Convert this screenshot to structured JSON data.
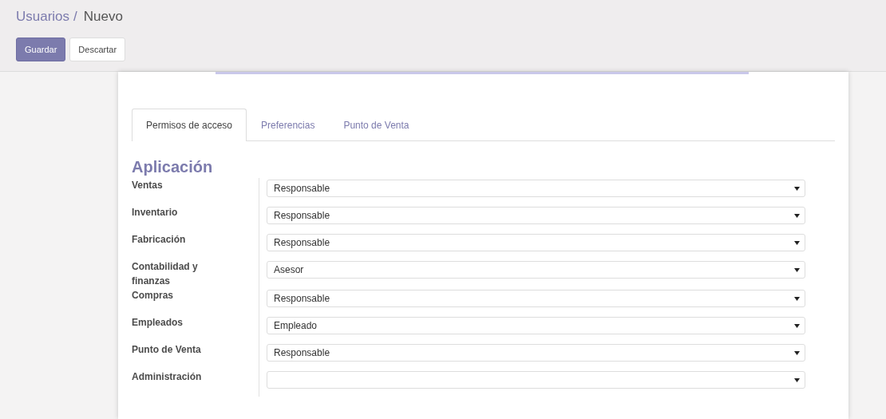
{
  "breadcrumb": {
    "parent": "Usuarios",
    "separator": "/",
    "current": "Nuevo"
  },
  "buttons": [
    {
      "label": "Guardar",
      "kind": "primary"
    },
    {
      "label": "Descartar",
      "kind": "secondary"
    }
  ],
  "tabs": [
    {
      "label": "Permisos de acceso",
      "selected": true
    },
    {
      "label": "Preferencias",
      "selected": false
    },
    {
      "label": "Punto de Venta",
      "selected": false
    }
  ],
  "section_title": "Aplicación",
  "fields": [
    {
      "label": "Ventas",
      "value": "Responsable"
    },
    {
      "label": "Inventario",
      "value": "Responsable"
    },
    {
      "label": "Fabricación",
      "value": "Responsable"
    },
    {
      "label": "Contabilidad y finanzas",
      "value": "Asesor"
    },
    {
      "label": "Compras",
      "value": "Responsable"
    },
    {
      "label": "Empleados",
      "value": "Empleado"
    },
    {
      "label": "Punto de Venta",
      "value": "Responsable"
    },
    {
      "label": "Administración"
    }
  ]
}
